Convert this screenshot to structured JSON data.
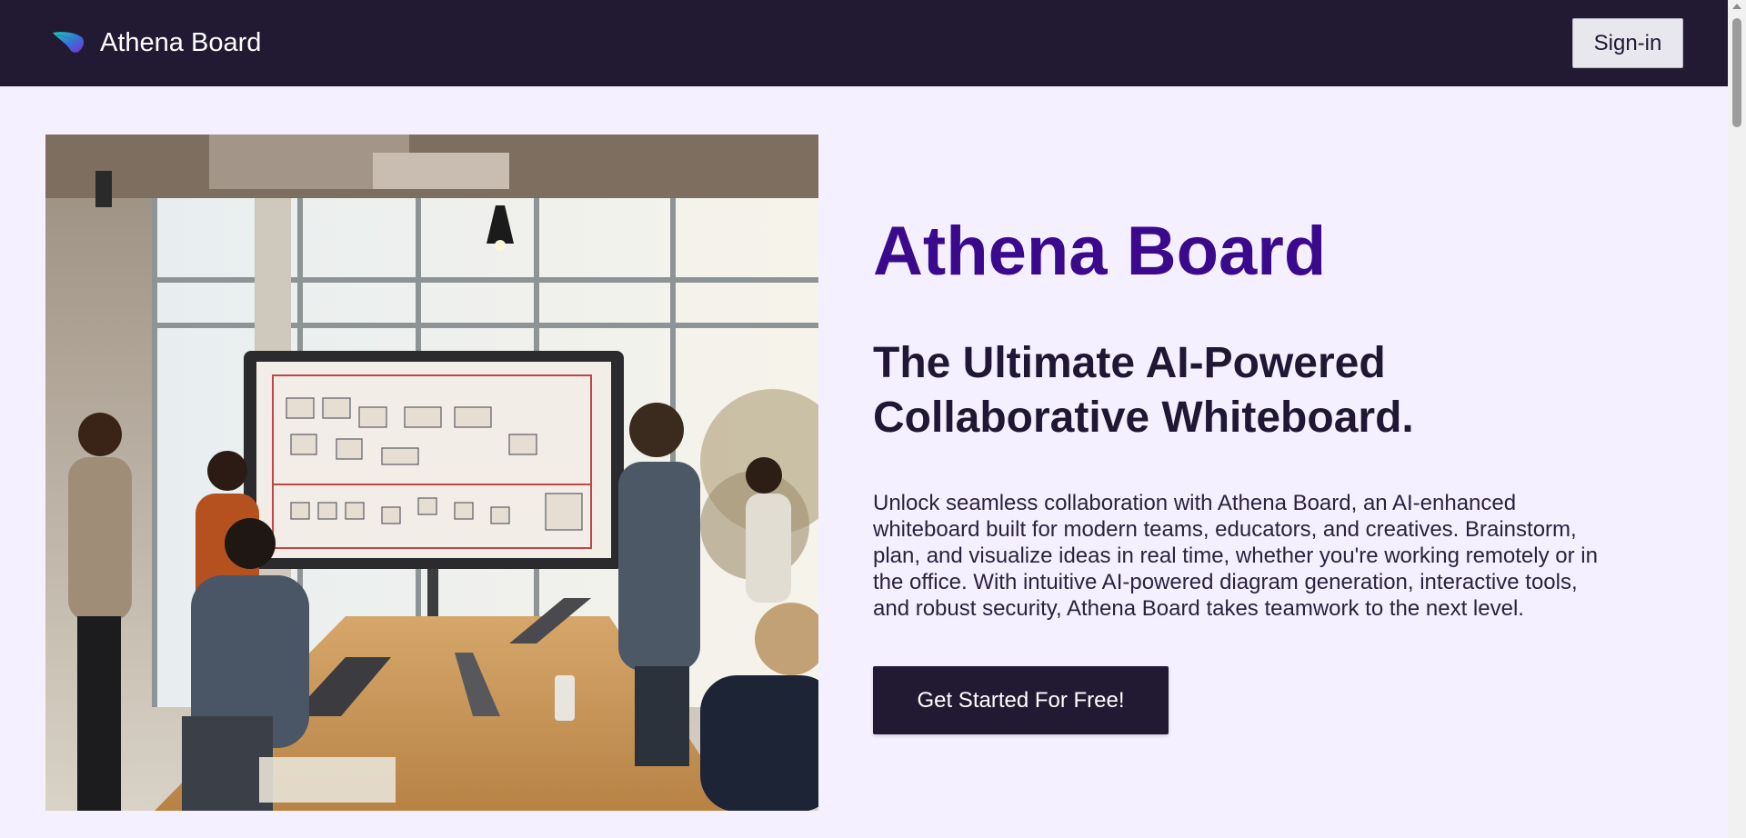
{
  "header": {
    "brand": "Athena Board",
    "logo_icon": "athena-feather-logo-icon",
    "signin_label": "Sign-in"
  },
  "hero": {
    "image_alt": "Team collaborating around a large digital whiteboard in an office",
    "title": "Athena Board",
    "subtitle": "The Ultimate AI-Powered Collaborative Whiteboard.",
    "description": "Unlock seamless collaboration with Athena Board, an AI-enhanced whiteboard built for modern teams, educators, and creatives. Brainstorm, plan, and visualize ideas in real time, whether you're working remotely or in the office. With intuitive AI-powered diagram generation, interactive tools, and robust security, Athena Board takes teamwork to the next level.",
    "cta_label": "Get Started For Free!"
  },
  "colors": {
    "header_bg": "#221a33",
    "page_bg": "#f5f0ff",
    "title_purple": "#3b0a8c",
    "cta_bg": "#221a33"
  }
}
